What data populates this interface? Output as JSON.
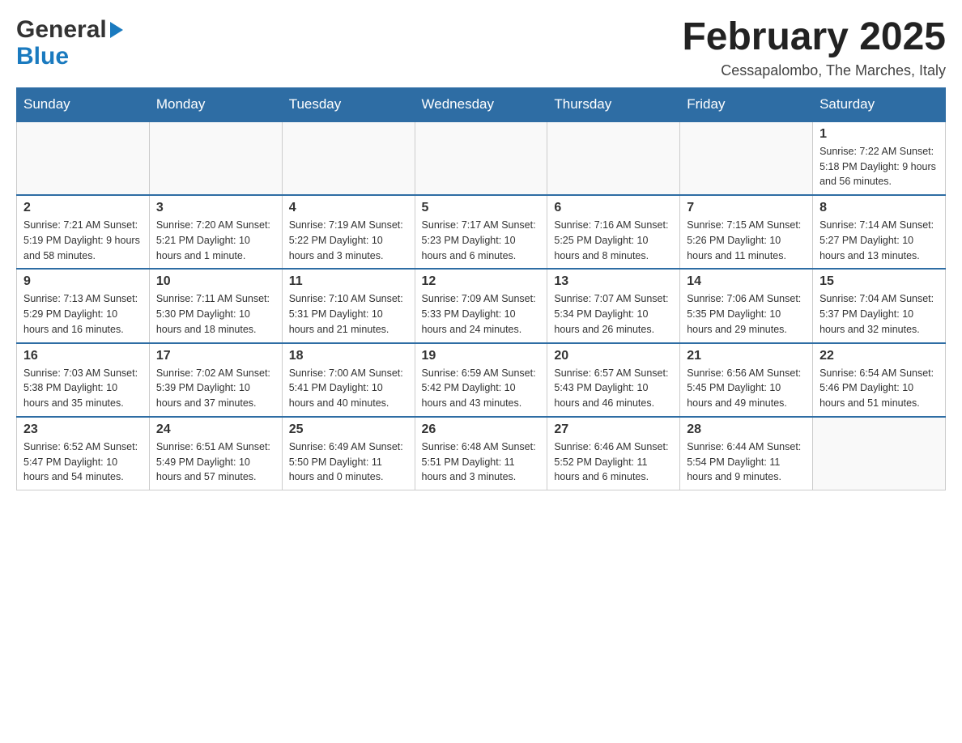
{
  "header": {
    "logo_general": "General",
    "logo_blue": "Blue",
    "month_title": "February 2025",
    "location": "Cessapalombo, The Marches, Italy"
  },
  "days_of_week": [
    "Sunday",
    "Monday",
    "Tuesday",
    "Wednesday",
    "Thursday",
    "Friday",
    "Saturday"
  ],
  "weeks": [
    [
      {
        "day": "",
        "info": ""
      },
      {
        "day": "",
        "info": ""
      },
      {
        "day": "",
        "info": ""
      },
      {
        "day": "",
        "info": ""
      },
      {
        "day": "",
        "info": ""
      },
      {
        "day": "",
        "info": ""
      },
      {
        "day": "1",
        "info": "Sunrise: 7:22 AM\nSunset: 5:18 PM\nDaylight: 9 hours and 56 minutes."
      }
    ],
    [
      {
        "day": "2",
        "info": "Sunrise: 7:21 AM\nSunset: 5:19 PM\nDaylight: 9 hours and 58 minutes."
      },
      {
        "day": "3",
        "info": "Sunrise: 7:20 AM\nSunset: 5:21 PM\nDaylight: 10 hours and 1 minute."
      },
      {
        "day": "4",
        "info": "Sunrise: 7:19 AM\nSunset: 5:22 PM\nDaylight: 10 hours and 3 minutes."
      },
      {
        "day": "5",
        "info": "Sunrise: 7:17 AM\nSunset: 5:23 PM\nDaylight: 10 hours and 6 minutes."
      },
      {
        "day": "6",
        "info": "Sunrise: 7:16 AM\nSunset: 5:25 PM\nDaylight: 10 hours and 8 minutes."
      },
      {
        "day": "7",
        "info": "Sunrise: 7:15 AM\nSunset: 5:26 PM\nDaylight: 10 hours and 11 minutes."
      },
      {
        "day": "8",
        "info": "Sunrise: 7:14 AM\nSunset: 5:27 PM\nDaylight: 10 hours and 13 minutes."
      }
    ],
    [
      {
        "day": "9",
        "info": "Sunrise: 7:13 AM\nSunset: 5:29 PM\nDaylight: 10 hours and 16 minutes."
      },
      {
        "day": "10",
        "info": "Sunrise: 7:11 AM\nSunset: 5:30 PM\nDaylight: 10 hours and 18 minutes."
      },
      {
        "day": "11",
        "info": "Sunrise: 7:10 AM\nSunset: 5:31 PM\nDaylight: 10 hours and 21 minutes."
      },
      {
        "day": "12",
        "info": "Sunrise: 7:09 AM\nSunset: 5:33 PM\nDaylight: 10 hours and 24 minutes."
      },
      {
        "day": "13",
        "info": "Sunrise: 7:07 AM\nSunset: 5:34 PM\nDaylight: 10 hours and 26 minutes."
      },
      {
        "day": "14",
        "info": "Sunrise: 7:06 AM\nSunset: 5:35 PM\nDaylight: 10 hours and 29 minutes."
      },
      {
        "day": "15",
        "info": "Sunrise: 7:04 AM\nSunset: 5:37 PM\nDaylight: 10 hours and 32 minutes."
      }
    ],
    [
      {
        "day": "16",
        "info": "Sunrise: 7:03 AM\nSunset: 5:38 PM\nDaylight: 10 hours and 35 minutes."
      },
      {
        "day": "17",
        "info": "Sunrise: 7:02 AM\nSunset: 5:39 PM\nDaylight: 10 hours and 37 minutes."
      },
      {
        "day": "18",
        "info": "Sunrise: 7:00 AM\nSunset: 5:41 PM\nDaylight: 10 hours and 40 minutes."
      },
      {
        "day": "19",
        "info": "Sunrise: 6:59 AM\nSunset: 5:42 PM\nDaylight: 10 hours and 43 minutes."
      },
      {
        "day": "20",
        "info": "Sunrise: 6:57 AM\nSunset: 5:43 PM\nDaylight: 10 hours and 46 minutes."
      },
      {
        "day": "21",
        "info": "Sunrise: 6:56 AM\nSunset: 5:45 PM\nDaylight: 10 hours and 49 minutes."
      },
      {
        "day": "22",
        "info": "Sunrise: 6:54 AM\nSunset: 5:46 PM\nDaylight: 10 hours and 51 minutes."
      }
    ],
    [
      {
        "day": "23",
        "info": "Sunrise: 6:52 AM\nSunset: 5:47 PM\nDaylight: 10 hours and 54 minutes."
      },
      {
        "day": "24",
        "info": "Sunrise: 6:51 AM\nSunset: 5:49 PM\nDaylight: 10 hours and 57 minutes."
      },
      {
        "day": "25",
        "info": "Sunrise: 6:49 AM\nSunset: 5:50 PM\nDaylight: 11 hours and 0 minutes."
      },
      {
        "day": "26",
        "info": "Sunrise: 6:48 AM\nSunset: 5:51 PM\nDaylight: 11 hours and 3 minutes."
      },
      {
        "day": "27",
        "info": "Sunrise: 6:46 AM\nSunset: 5:52 PM\nDaylight: 11 hours and 6 minutes."
      },
      {
        "day": "28",
        "info": "Sunrise: 6:44 AM\nSunset: 5:54 PM\nDaylight: 11 hours and 9 minutes."
      },
      {
        "day": "",
        "info": ""
      }
    ]
  ]
}
